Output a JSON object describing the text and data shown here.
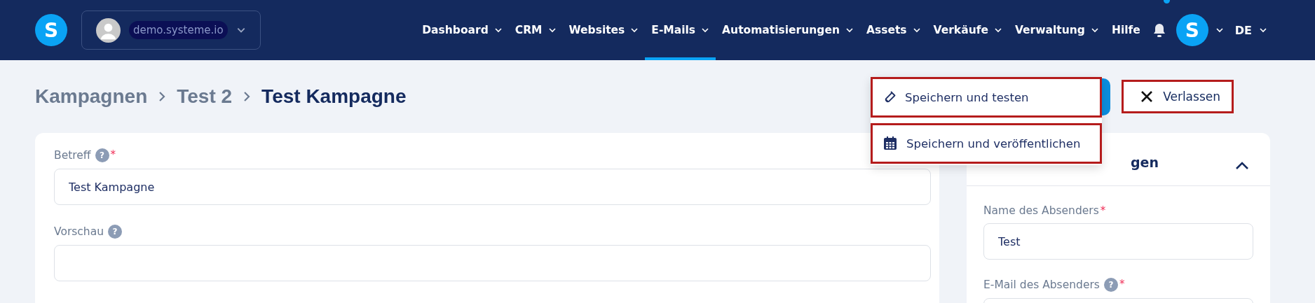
{
  "account": {
    "name": "demo.systeme.io"
  },
  "nav": [
    {
      "label": "Dashboard",
      "selected": false,
      "has_menu": true
    },
    {
      "label": "CRM",
      "selected": false,
      "has_menu": true
    },
    {
      "label": "Websites",
      "selected": false,
      "has_menu": true
    },
    {
      "label": "E-Mails",
      "selected": true,
      "has_menu": true
    },
    {
      "label": "Automatisierungen",
      "selected": false,
      "has_menu": true
    },
    {
      "label": "Assets",
      "selected": false,
      "has_menu": true
    },
    {
      "label": "Verkäufe",
      "selected": false,
      "has_menu": true
    },
    {
      "label": "Verwaltung",
      "selected": false,
      "has_menu": true
    },
    {
      "label": "Hilfe",
      "selected": false,
      "has_menu": false
    }
  ],
  "notifications": {
    "unread": true
  },
  "user": {
    "initial": "S"
  },
  "logo": {
    "initial": "S"
  },
  "language": "DE",
  "breadcrumb": [
    {
      "label": "Kampagnen",
      "current": false
    },
    {
      "label": "Test 2",
      "current": false
    },
    {
      "label": "Test Kampagne",
      "current": true
    }
  ],
  "save_menu": {
    "expanded": true,
    "items": [
      {
        "label": "Speichern und testen",
        "kind": "test",
        "highlighted": true
      },
      {
        "label": "Speichern und veröffentlichen",
        "kind": "publish",
        "highlighted": true
      }
    ]
  },
  "exit_button": {
    "label": "Verlassen",
    "highlighted": true
  },
  "form": [
    {
      "label": "Betreff",
      "help": "?",
      "required": "*",
      "value": "Test Kampagne"
    },
    {
      "label": "Vorschau",
      "help": "?"
    }
  ],
  "settings_panel": {
    "title_visible": "gen",
    "expanded": true,
    "fields": [
      {
        "label": "Name des Absenders",
        "required": "*",
        "value": "Test"
      },
      {
        "label": "E-Mail des Absenders",
        "help": "?",
        "required": "*"
      }
    ]
  }
}
